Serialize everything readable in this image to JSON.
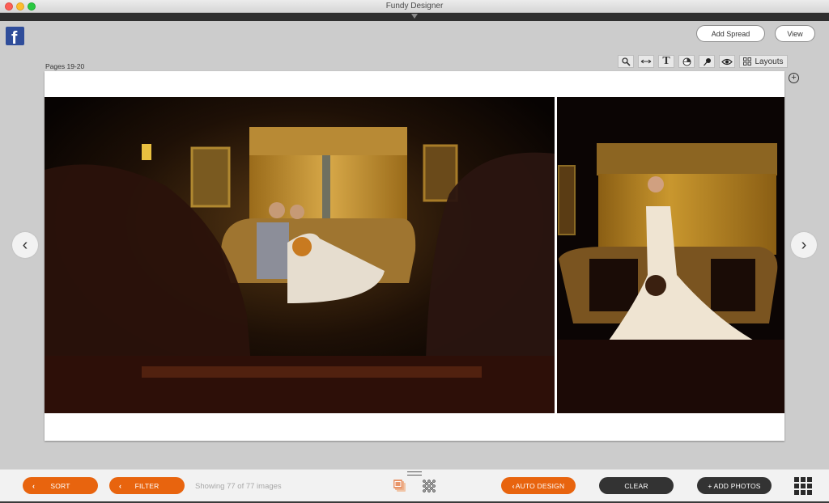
{
  "window": {
    "title": "Fundy Designer"
  },
  "header": {
    "social_icon": "facebook-icon",
    "add_spread_label": "Add Spread",
    "view_label": "View"
  },
  "spread": {
    "pages_label": "Pages 19-20",
    "toolbar": {
      "tools": [
        "magnifier-icon",
        "arrow-width-icon",
        "text-icon",
        "pie-icon",
        "pin-icon",
        "eye-icon"
      ],
      "text_tool_glyph": "T",
      "layouts_label": "Layouts"
    },
    "left_photo": "Couple kissing on leather sofa in dim wood-paneled room with gold curtains",
    "right_photo": "Bride standing in front of leather sofa and gold curtains holding bouquet"
  },
  "navigation": {
    "prev_glyph": "‹",
    "next_glyph": "›",
    "zoom_in_glyph": "+"
  },
  "bottom_bar": {
    "sort_label": "SORT",
    "filter_label": "FILTER",
    "showing_text": "Showing 77 of 77 images",
    "auto_design_label": "AUTO DESIGN",
    "clear_label": "CLEAR",
    "add_photos_label": "+ ADD PHOTOS",
    "chevron_glyph": "‹"
  },
  "colors": {
    "accent_orange": "#e8640e",
    "dark_button": "#333333",
    "facebook_blue": "#2f4d9a"
  }
}
